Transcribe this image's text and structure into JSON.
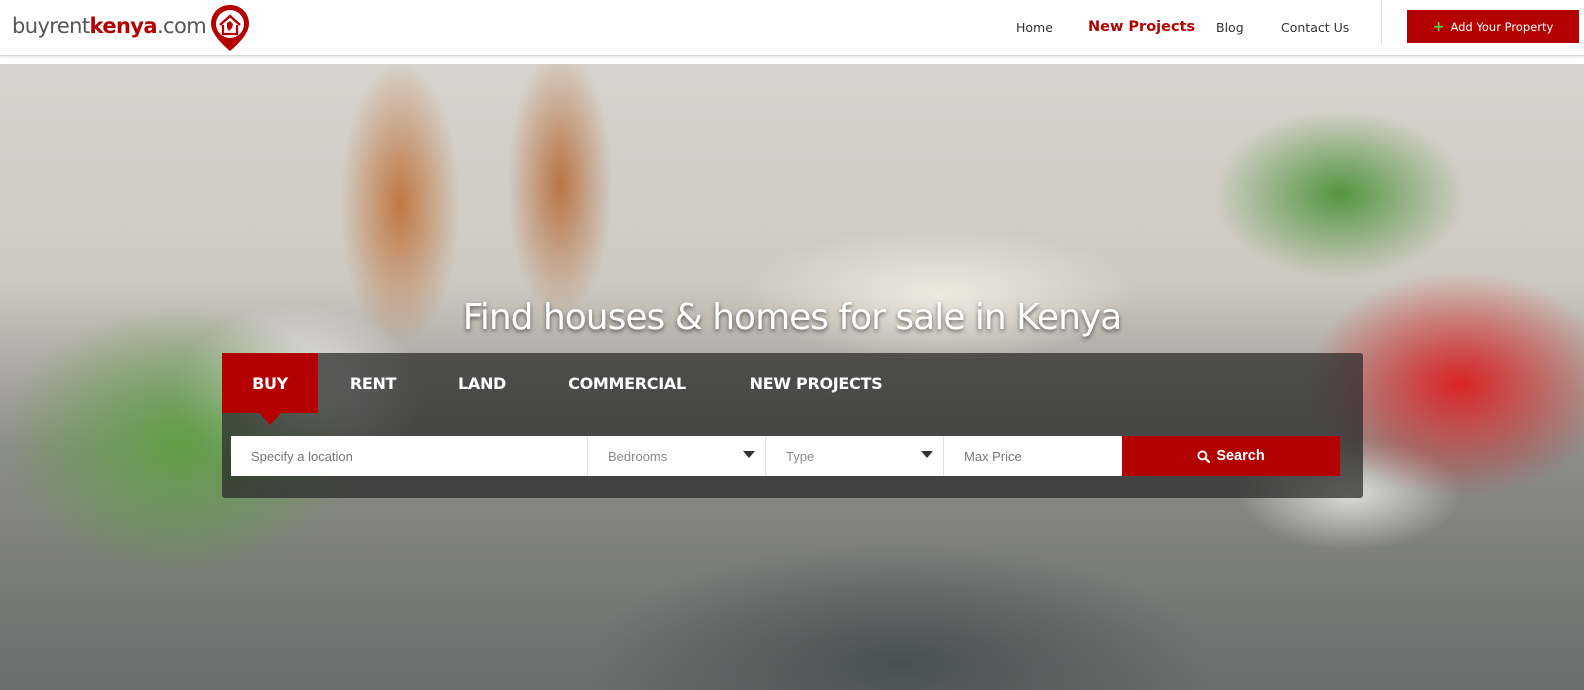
{
  "header": {
    "logo": {
      "part1": "buyrent",
      "part2": "kenya",
      "part3": ".com"
    },
    "nav": [
      {
        "label": "Home",
        "highlight": false
      },
      {
        "label": "New Projects",
        "highlight": true
      },
      {
        "label": "Blog",
        "highlight": false
      },
      {
        "label": "Contact Us",
        "highlight": false
      }
    ],
    "add_property": {
      "label": "Add Your Property",
      "icon": "plus-icon"
    }
  },
  "hero": {
    "title": "Find houses & homes for sale in Kenya",
    "tabs": [
      {
        "label": "BUY",
        "active": true
      },
      {
        "label": "RENT",
        "active": false
      },
      {
        "label": "LAND",
        "active": false
      },
      {
        "label": "COMMERCIAL",
        "active": false
      },
      {
        "label": "NEW PROJECTS",
        "active": false
      }
    ],
    "search": {
      "location_placeholder": "Specify a location",
      "bedrooms_label": "Bedrooms",
      "type_label": "Type",
      "max_price_placeholder": "Max Price",
      "button_label": "Search",
      "button_icon": "search-icon"
    }
  },
  "colors": {
    "brand_red": "#b30000",
    "plus_green": "#4cdb42"
  }
}
